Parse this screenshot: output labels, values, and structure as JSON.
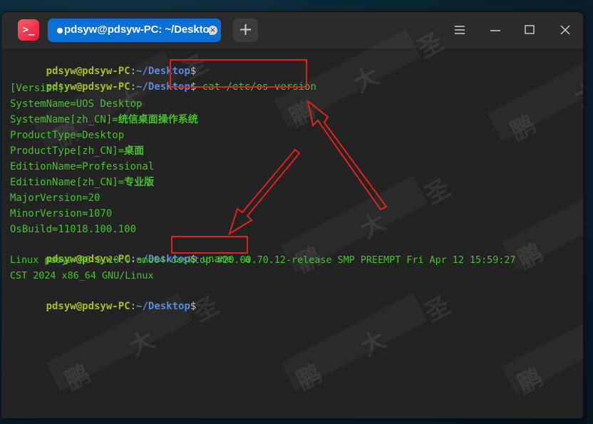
{
  "app": {
    "icon_glyph": ">_"
  },
  "tab": {
    "title": "pdsyw@pdsyw-PC: ~/Desktop",
    "close_glyph": "×"
  },
  "new_tab": {
    "label": "+"
  },
  "window_controls": [
    "menu-icon",
    "minimize-icon",
    "maximize-icon",
    "close-icon"
  ],
  "prompt": {
    "user": "pdsyw@pdsyw-PC",
    "sep": ":",
    "path": "~/Desktop",
    "sym": "$"
  },
  "commands": {
    "cmd1": " cat /etc/os-version",
    "cmd2": " uname -a"
  },
  "output": {
    "os_version": [
      "[Version]",
      "SystemName=UOS Desktop",
      "SystemName[zh_CN]=",
      "ProductType=Desktop",
      "ProductType[zh_CN]=",
      "EditionName=Professional",
      "EditionName[zh_CN]=",
      "MajorVersion=20",
      "MinorVersion=1070",
      "OsBuild=11018.100.100"
    ],
    "os_version_cjk": {
      "system_name_zh": "统信桌面操作系统",
      "product_type_zh": "桌面",
      "edition_name_zh": "专业版"
    },
    "uname": [
      "Linux pdsyw-PC 5.10.0-amd64-desktop #20.00.70.12-release SMP PREEMPT Fri Apr 12 15:59:27",
      "CST 2024 x86_64 GNU/Linux"
    ]
  },
  "watermark": "鹏 大 圣",
  "colors": {
    "accent_tab": "#0b6fd6",
    "prompt_user": "#a0c02a",
    "prompt_path": "#5a8ad8",
    "output": "#48c030",
    "annotation": "#e02020"
  }
}
